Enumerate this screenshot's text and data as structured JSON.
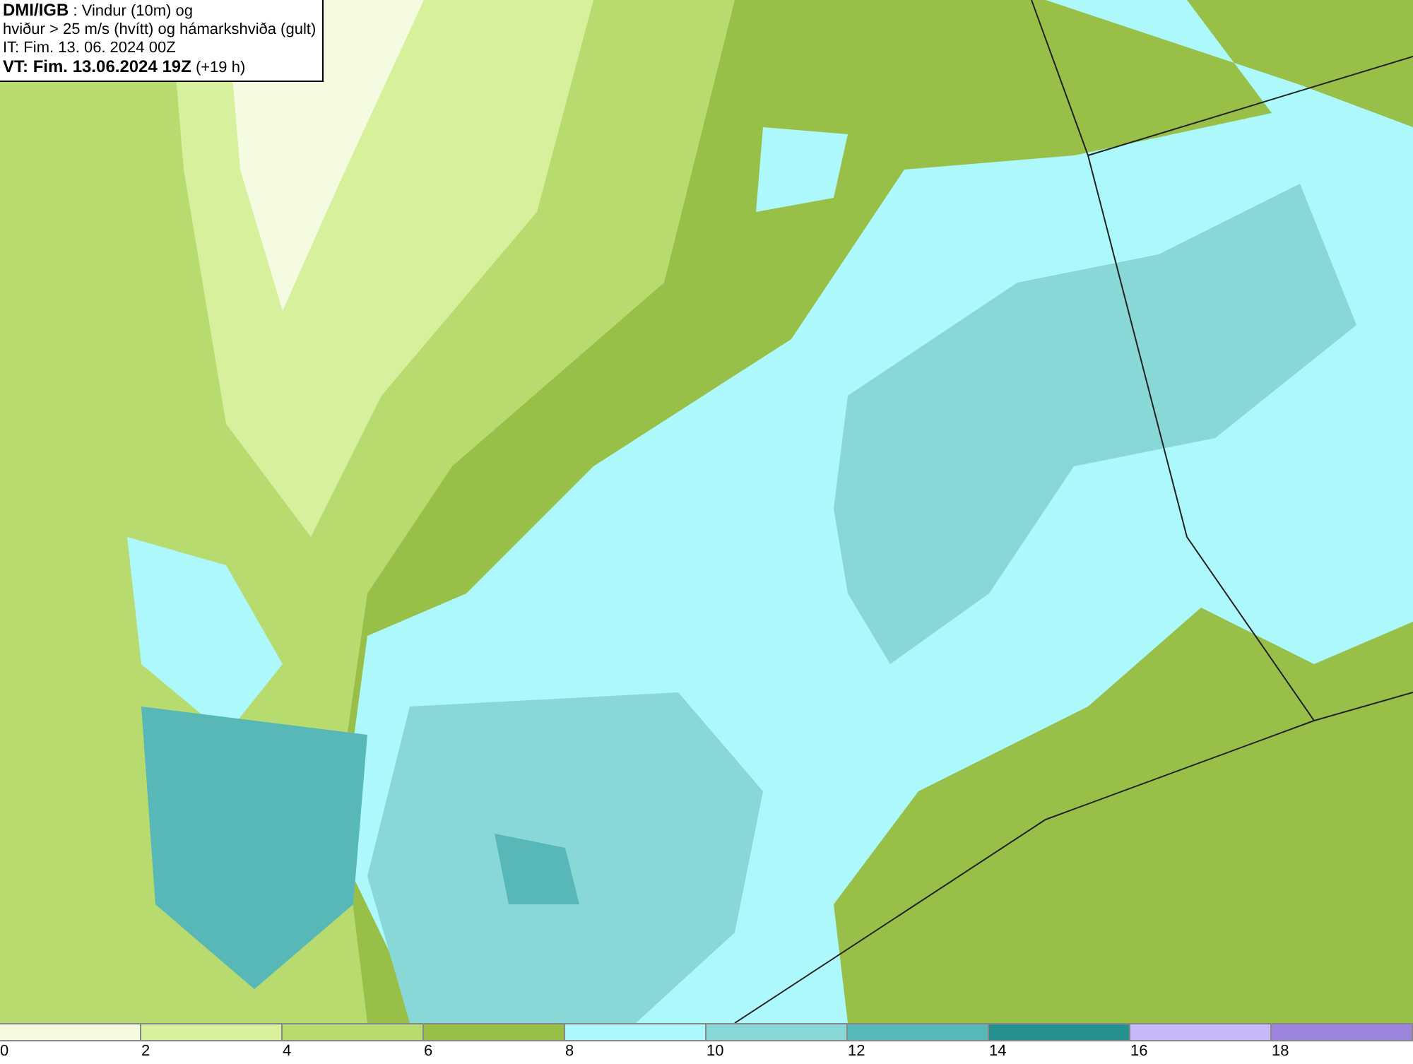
{
  "title_box": {
    "lines": [
      "**DMI/IGB** : Vindur (10m) og",
      "hviður > 25 m/s (hvítt) og hámarkshviða (gult)",
      "IT: Fim. 13. 06. 2024 00Z",
      "**VT: Fim. 13.06.2024 19Z** (+19 h)"
    ]
  },
  "legend": [
    {
      "label": "0",
      "color": "#f5fbe0"
    },
    {
      "label": "2",
      "color": "#d7f09c"
    },
    {
      "label": "4",
      "color": "#b8db70"
    },
    {
      "label": "6",
      "color": "#98c048"
    },
    {
      "label": "8",
      "color": "#adf8fa"
    },
    {
      "label": "10",
      "color": "#88d8d8"
    },
    {
      "label": "12",
      "color": "#58b8b8"
    },
    {
      "label": "14",
      "color": "#279090"
    },
    {
      "label": "16",
      "color": "#c7b8f8"
    },
    {
      "label": "18",
      "color": "#9c84dc"
    }
  ]
}
